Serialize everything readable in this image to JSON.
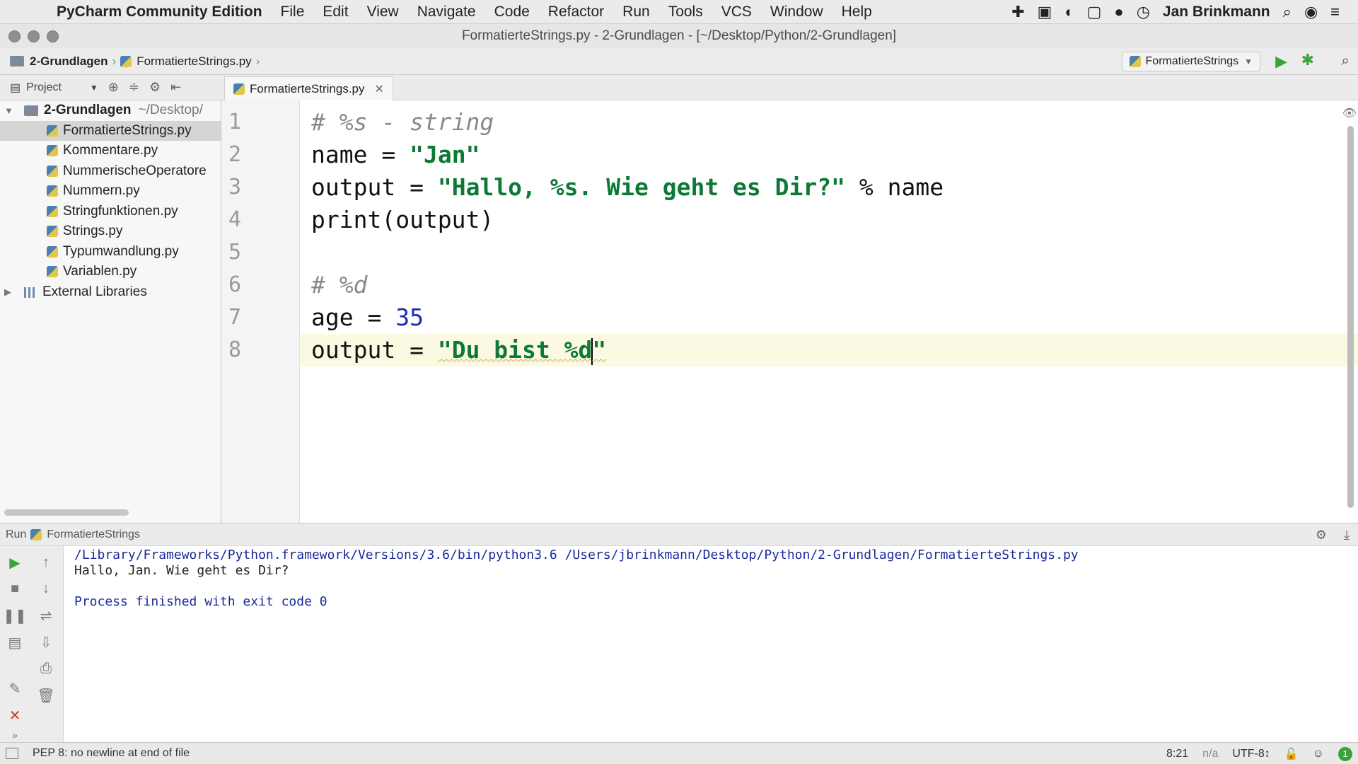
{
  "menubar": {
    "app_name": "PyCharm Community Edition",
    "items": [
      "File",
      "Edit",
      "View",
      "Navigate",
      "Code",
      "Refactor",
      "Run",
      "Tools",
      "VCS",
      "Window",
      "Help"
    ],
    "user": "Jan Brinkmann",
    "icons": [
      "puzzle-icon",
      "briefcase-icon",
      "leaf-icon",
      "camera-icon",
      "chat-icon",
      "clock-icon",
      "search-icon",
      "siri-icon",
      "list-icon"
    ]
  },
  "window": {
    "title": "FormatierteStrings.py - 2-Grundlagen - [~/Desktop/Python/2-Grundlagen]"
  },
  "navbar": {
    "project": "2-Grundlagen",
    "file": "FormatierteStrings.py",
    "run_config": "FormatierteStrings"
  },
  "project_panel": {
    "label": "Project",
    "root": "2-Grundlagen",
    "root_path": "~/Desktop/",
    "files": [
      "FormatierteStrings.py",
      "Kommentare.py",
      "NummerischeOperatore",
      "Nummern.py",
      "Stringfunktionen.py",
      "Strings.py",
      "Typumwandlung.py",
      "Variablen.py"
    ],
    "external": "External Libraries"
  },
  "editor": {
    "tab_label": "FormatierteStrings.py",
    "line_numbers": [
      "1",
      "2",
      "3",
      "4",
      "5",
      "6",
      "7",
      "8"
    ],
    "code": {
      "l1_comment": "# %s - string",
      "l2_var": "name",
      "l2_eq": " = ",
      "l2_str": "\"Jan\"",
      "l3_var": "output",
      "l3_eq": " = ",
      "l3_str": "\"Hallo, %s. Wie geht es Dir?\"",
      "l3_rest": " % name",
      "l4_code": "print(output)",
      "l6_comment": "# %d",
      "l7_var": "age",
      "l7_eq": " = ",
      "l7_num": "35",
      "l8_var": "output",
      "l8_eq": " = ",
      "l8_str_a": "\"Du bist %d",
      "l8_str_b": "\""
    }
  },
  "run_panel": {
    "label": "Run",
    "config": "FormatierteStrings",
    "output": [
      "/Library/Frameworks/Python.framework/Versions/3.6/bin/python3.6 /Users/jbrinkmann/Desktop/Python/2-Grundlagen/FormatierteStrings.py",
      "Hallo, Jan. Wie geht es Dir?",
      "",
      "Process finished with exit code 0"
    ]
  },
  "statusbar": {
    "message": "PEP 8: no newline at end of file",
    "position": "8:21",
    "na": "n/a",
    "encoding": "UTF-8↕"
  },
  "colors": {
    "string": "#0c7a36",
    "number": "#1b2ab8",
    "comment": "#8a8a8a",
    "run_green": "#3aa33a",
    "stop_red": "#d9342b"
  }
}
